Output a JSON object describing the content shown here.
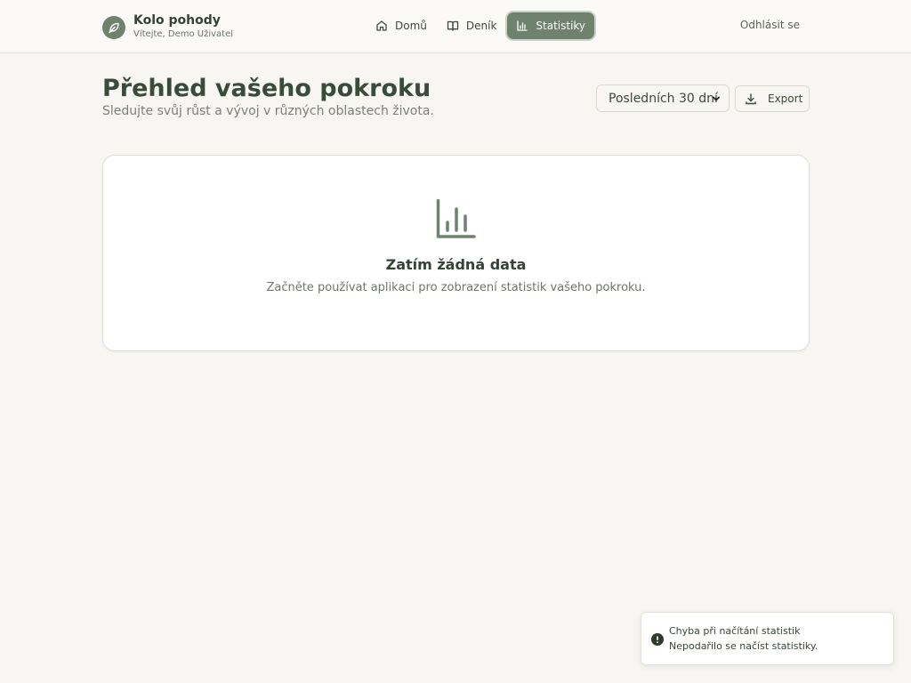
{
  "header": {
    "app_name": "Kolo pohody",
    "welcome": "Vítejte, Demo Uživatel",
    "logo_icon": "leaf-icon",
    "nav": [
      {
        "label": "Domů",
        "icon": "home-icon"
      },
      {
        "label": "Deník",
        "icon": "book-icon"
      },
      {
        "label": "Statistiky",
        "icon": "bar-chart-icon",
        "active": true
      }
    ],
    "logout": "Odhlásit se"
  },
  "page": {
    "title": "Přehled vašeho pokroku",
    "subtitle": "Sledujte svůj růst a vývoj v různých oblastech života.",
    "range_selected": "Posledních 30 dní",
    "export_label": "Export"
  },
  "empty_state": {
    "icon": "bar-chart-icon",
    "title": "Zatím žádná data",
    "text": "Začněte používat aplikaci pro zobrazení statistik vašeho pokroku."
  },
  "toast": {
    "icon": "alert-circle-icon",
    "title": "Chyba při načítání statistik",
    "text": "Nepodařilo se načíst statistiky."
  },
  "colors": {
    "accent": "#6e826e",
    "background": "#f7f6f2",
    "heading": "#394c3b"
  }
}
